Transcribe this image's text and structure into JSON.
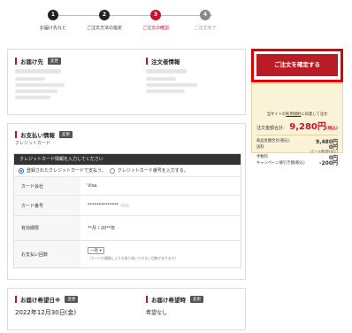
{
  "steps": [
    {
      "num": "1",
      "label": "お届け先など"
    },
    {
      "num": "2",
      "label": "ご注文方法の指定"
    },
    {
      "num": "3",
      "label": "ご注文の確認"
    },
    {
      "num": "4",
      "label": "ご注文完了"
    }
  ],
  "address": {
    "delivery_title": "お届け先",
    "orderer_title": "注文者情報",
    "change_label": "変更"
  },
  "payment": {
    "title": "お支払い情報",
    "change_label": "変更",
    "method": "クレジットカード",
    "card_header": "クレジットカード情報を入力してください",
    "radio_registered": "登録されたクレジットカードで支払う。",
    "radio_new": "クレジットカード番号を入力する。",
    "rows": {
      "brand_label": "カード会社",
      "brand_value": "Visa",
      "number_label": "カード番号",
      "number_value": "**************",
      "expiry_label": "有効期限",
      "expiry_value": "**月 / 20**年",
      "installments_label": "お支払い回数",
      "installments_value": "一括",
      "installments_note": "（カードの種類によりお取り扱いできない回数があります）"
    }
  },
  "delivery": {
    "date_title": "お届け希望日※",
    "date_change": "変更",
    "date_value": "2022年12月30日(金)",
    "time_title": "お届け希望時",
    "time_change": "変更",
    "time_value": "希望なし"
  },
  "summary": {
    "confirm_button": "ご注文を確定する",
    "agree_prefix": "当サイトの",
    "agree_link": "利用規約",
    "agree_suffix": "に同意して注文",
    "total_label": "注文金額合計:",
    "total_value": "9,280円",
    "total_tax": "(税込)",
    "items": [
      {
        "label": "商品金額合計(税込)",
        "value": "9,480円"
      },
      {
        "label": "送料",
        "value": "0円"
      },
      {
        "label": "手数料",
        "value": "0円"
      },
      {
        "label": "キャンペーン値引き額(税込)",
        "value": "-200円"
      }
    ],
    "shipping_note": "(クール便送料含む)"
  },
  "colors": {
    "accent": "#c8102e",
    "confirm_button": "#b81d25",
    "highlight_border": "#e00000",
    "summary_bg": "#fbf3d8"
  }
}
